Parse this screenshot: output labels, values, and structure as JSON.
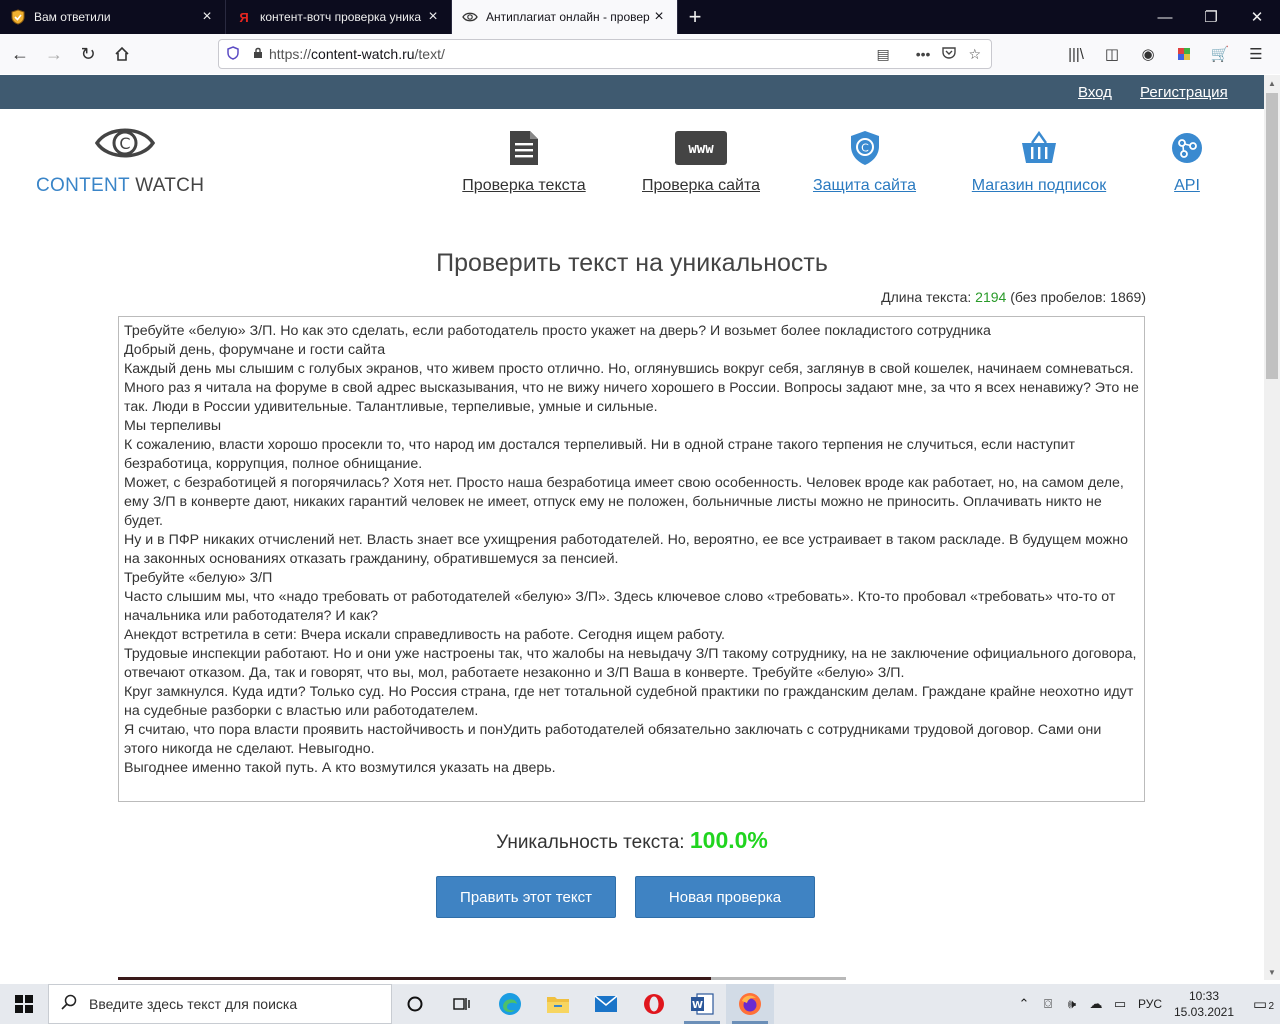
{
  "browser": {
    "tabs": [
      {
        "title": "Вам ответили",
        "favicon": "shield-badge"
      },
      {
        "title": "контент-вотч проверка уника",
        "favicon": "yandex-y"
      },
      {
        "title": "Антиплагиат онлайн - провер",
        "favicon": "eye"
      }
    ],
    "url_scheme": "https://",
    "url_host": "content-watch.ru",
    "url_path": "/text/"
  },
  "site": {
    "top_links": {
      "login": "Вход",
      "register": "Регистрация"
    },
    "logo": {
      "part1": "CONTENT",
      "part2": "WATCH"
    },
    "menu": [
      {
        "label": "Проверка текста",
        "icon": "document-icon"
      },
      {
        "label": "Проверка сайта",
        "icon": "www-icon",
        "icon_text": "www"
      },
      {
        "label": "Защита сайта",
        "icon": "shield-copyright-icon"
      },
      {
        "label": "Магазин подписок",
        "icon": "basket-icon"
      },
      {
        "label": "API",
        "icon": "api-nodes-icon"
      }
    ],
    "colors": {
      "header": "#3f5a70",
      "accent": "#3f83c3",
      "link": "#2a7ac0",
      "unique": "#21d41f"
    }
  },
  "check": {
    "heading": "Проверить текст на уникальность",
    "length_label": "Длина текста:",
    "length_value": "2194",
    "length_nospaces": "(без пробелов: 1869)",
    "text_lines": [
      "Требуйте «белую» З/П. Но как это сделать, если работодатель просто укажет на дверь? И возьмет более покладистого сотрудника",
      "Добрый день, форумчане и гости сайта",
      "Каждый день мы слышим с голубых экранов, что живем просто отлично. Но, оглянувшись вокруг себя, заглянув в свой кошелек, начинаем сомневаться.",
      "Много раз я читала на форуме в свой адрес высказывания, что не вижу ничего хорошего в России. Вопросы задают мне, за что я всех ненавижу? Это не так. Люди в России удивительные. Талантливые, терпеливые, умные и сильные.",
      "Мы терпеливы",
      "К сожалению, власти хорошо просекли то, что народ им достался терпеливый. Ни в одной стране такого терпения не случиться, если наступит безработица, коррупция, полное обнищание.",
      "Может, с безработицей я погорячилась? Хотя нет. Просто наша безработица имеет свою особенность. Человек вроде как работает, но, на самом деле, ему З/П в конверте дают, никаких гарантий человек не имеет, отпуск ему не положен, больничные листы можно не приносить. Оплачивать никто не будет.",
      "Ну и в ПФР никаких отчислений нет. Власть знает все ухищрения работодателей. Но, вероятно, ее все устраивает в таком раскладе. В будущем можно на законных основаниях отказать гражданину, обратившемуся за пенсией.",
      "Требуйте «белую» З/П",
      "Часто слышим мы, что «надо требовать от работодателей «белую» З/П». Здесь ключевое слово «требовать». Кто-то пробовал «требовать» что-то от начальника или работодателя? И как?",
      "Анекдот встретила в сети: Вчера искали справедливость на работе. Сегодня ищем работу.",
      "Трудовые инспекции работают. Но и они уже настроены так, что жалобы на невыдачу З/П такому сотруднику, на не заключение официального договора, отвечают отказом. Да, так и говорят, что вы, мол, работаете незаконно и З/П Ваша в конверте. Требуйте «белую» З/П.",
      "Круг замкнулся. Куда идти? Только суд. Но Россия страна, где нет тотальной судебной практики по гражданским делам. Граждане крайне неохотно идут на судебные разборки с властью или работодателем.",
      "Я считаю, что пора власти проявить настойчивость и понУдить работодателей обязательно заключать с сотрудниками трудовой договор. Сами они этого никогда не сделают. Невыгодно.",
      "Выгоднее именно такой путь. А кто возмутился указать на дверь."
    ],
    "uniqueness_label": "Уникальность текста:",
    "uniqueness_value": "100.0%",
    "edit_button": "Править этот текст",
    "new_button": "Новая проверка"
  },
  "taskbar": {
    "search_placeholder": "Введите здесь текст для поиска",
    "lang": "РУС",
    "time": "10:33",
    "date": "15.03.2021",
    "notifications": "2"
  }
}
